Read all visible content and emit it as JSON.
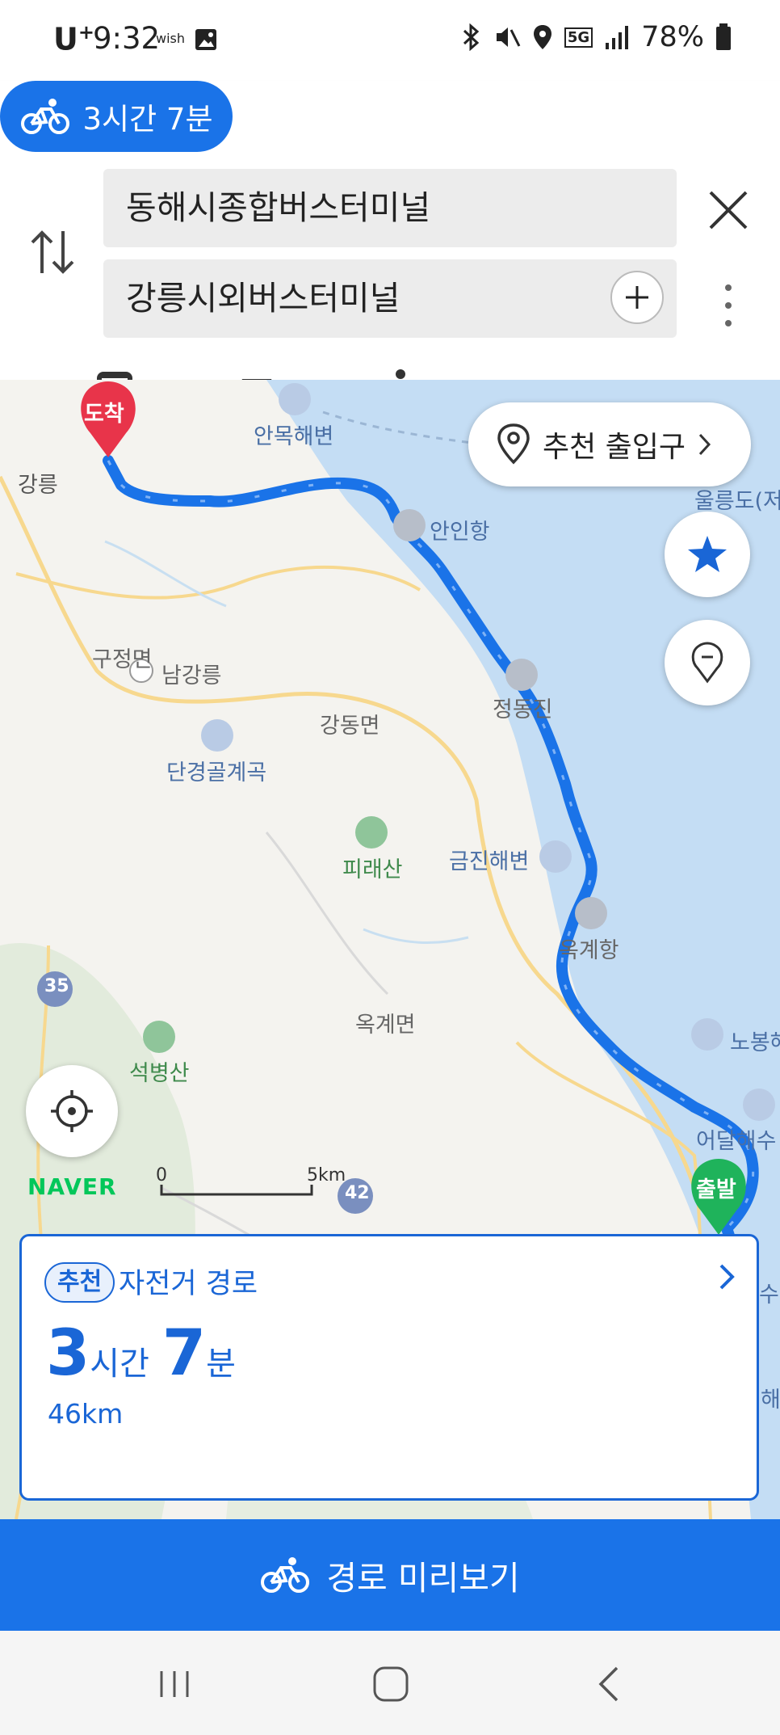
{
  "status_bar": {
    "carrier": "U",
    "carrier_sup": "+",
    "time": "9:32",
    "extra": "wish",
    "network": "5G",
    "battery": "78%"
  },
  "search": {
    "origin": "동해시종합버스터미널",
    "destination": "강릉시외버스터미널"
  },
  "modes": {
    "icons": [
      "bus-icon",
      "car-icon",
      "walk-icon",
      "bike-icon"
    ],
    "active_label": "3시간 7분"
  },
  "map": {
    "entrance_button": "추천 출입구",
    "arrival_marker": "도착",
    "departure_marker": "출발",
    "labels": {
      "anmok": "안목해변",
      "gangneung": "강릉",
      "anin": "안인항",
      "ulleung": "울릉도(저",
      "gujeong": "구정면",
      "namgangneung": "남강릉",
      "jeongdongjin": "정동진",
      "gangdong": "강동면",
      "dangyeong": "단경골계곡",
      "piraesan": "피래산",
      "geumjin": "금진해변",
      "okgye_port": "옥계항",
      "route35": "35",
      "okgye": "옥계면",
      "nobong": "노봉해",
      "seokbyeong": "석병산",
      "eodal": "어달해수",
      "route42": "42",
      "su": "수",
      "hae": "해"
    },
    "logo": "NAVER",
    "scale_start": "0",
    "scale_end": "5km",
    "colors": {
      "route": "#1a73e8",
      "sea": "#c4ddf4",
      "arrival": "#e8344a",
      "departure": "#1fb35b"
    }
  },
  "route_card": {
    "badge": "추천",
    "type": "자전거 경로",
    "hours": "3",
    "hours_unit": "시간",
    "minutes": "7",
    "minutes_unit": "분",
    "distance": "46km"
  },
  "preview_button": {
    "label": "경로 미리보기"
  }
}
